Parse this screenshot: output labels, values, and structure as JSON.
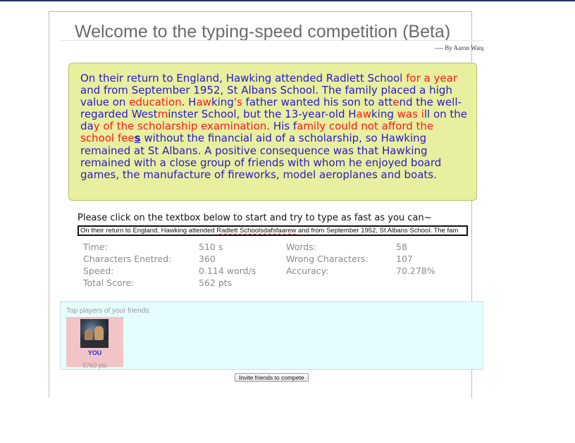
{
  "header": {
    "title": "Welcome to the typing-speed competition (Beta)",
    "byline": "---- By Aaron Wang"
  },
  "passage": {
    "segments": [
      {
        "text": "On their return to England, Hawking attended Radlett School ",
        "state": "ok"
      },
      {
        "text": "for a year",
        "state": "wrong"
      },
      {
        "text": " and from September 1952, St Albans School. The family placed a high value on ",
        "state": "ok"
      },
      {
        "text": "education",
        "state": "wrong"
      },
      {
        "text": ". H",
        "state": "ok"
      },
      {
        "text": "aw",
        "state": "wrong"
      },
      {
        "text": "king",
        "state": "ok"
      },
      {
        "text": "'s",
        "state": "wrong"
      },
      {
        "text": " father wanted his son to att",
        "state": "ok"
      },
      {
        "text": "e",
        "state": "wrong"
      },
      {
        "text": "nd the well-regarded West",
        "state": "ok"
      },
      {
        "text": "m",
        "state": "wrong"
      },
      {
        "text": "inster School, but the 13-year-old H",
        "state": "ok"
      },
      {
        "text": "aw",
        "state": "wrong"
      },
      {
        "text": "king ",
        "state": "ok"
      },
      {
        "text": "was i",
        "state": "wrong"
      },
      {
        "text": "ll on the da",
        "state": "ok"
      },
      {
        "text": "y of the scholarship examination. ",
        "state": "wrong"
      },
      {
        "text": "His f",
        "state": "ok"
      },
      {
        "text": "amily could not aff",
        "state": "wrong"
      },
      {
        "text": "ord the school fee",
        "state": "wrong"
      },
      {
        "text": "s",
        "state": "current"
      },
      {
        "text": " without the financial aid of a scholarship, so Hawking remained at St Albans. A positive consequence was that Hawking remained with a close group of friends with whom he enjoyed board games, the manufacture of fireworks, model aeroplanes and boats.",
        "state": "ok"
      }
    ]
  },
  "instruction": "Please click on the textbox below to start and try to type as fast as you can~",
  "typing_input": {
    "value_parts": [
      {
        "text": "On their return to England, Hawking attended ",
        "err": false
      },
      {
        "text": "Radlett Schoolsdafsfaarew",
        "err": true
      },
      {
        "text": " and from September 1952, St Albans School. The fam",
        "err": false
      }
    ]
  },
  "stats": {
    "time_label": "Time:",
    "time_value": "510 s",
    "words_label": "Words:",
    "words_value": "58",
    "chars_label": "Characters Enetred:",
    "chars_value": "360",
    "wrong_label": "Wrong Characters:",
    "wrong_value": "107",
    "speed_label": "Speed:",
    "speed_value": "0.114 word/s",
    "accuracy_label": "Accuracy:",
    "accuracy_value": "70.278%",
    "score_label": "Total Score:",
    "score_value": "562 pts"
  },
  "friends": {
    "title": "Top players of your friends:",
    "players": [
      {
        "name": "YOU",
        "points": "5760 pts"
      }
    ]
  },
  "invite_label": "Invite friends to compete",
  "colors": {
    "passage_bg": "#e8ef9e",
    "correct_text": "#2a1acb",
    "wrong_text": "#ff1a1a",
    "friends_bg": "#e6fdfd",
    "player_card_bg": "#f2c4c7"
  }
}
